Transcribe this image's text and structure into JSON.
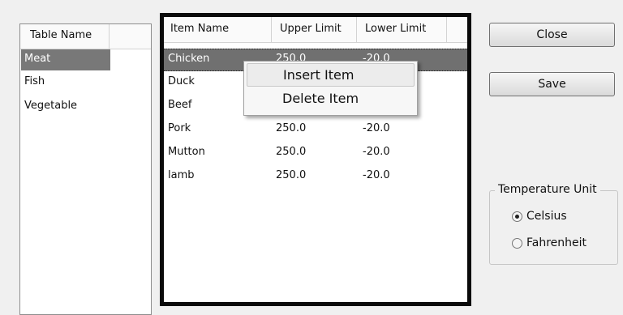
{
  "table_list": {
    "header": "Table Name",
    "items": [
      "Meat",
      "Fish",
      "Vegetable"
    ],
    "selected_index": 0
  },
  "items_table": {
    "columns": [
      "Item Name",
      "Upper Limit",
      "Lower Limit"
    ],
    "rows": [
      [
        "Chicken",
        "250.0",
        "-20.0"
      ],
      [
        "Duck",
        "",
        ""
      ],
      [
        "Beef",
        "",
        ""
      ],
      [
        "Pork",
        "250.0",
        "-20.0"
      ],
      [
        "Mutton",
        "250.0",
        "-20.0"
      ],
      [
        "lamb",
        "250.0",
        "-20.0"
      ]
    ],
    "selected_index": 0
  },
  "context_menu": {
    "items": [
      "Insert Item",
      "Delete Item"
    ]
  },
  "buttons": {
    "close": "Close",
    "save": "Save"
  },
  "temperature_unit": {
    "title": "Temperature Unit",
    "options": [
      "Celsius",
      "Fahrenheit"
    ],
    "selected": "Celsius"
  }
}
